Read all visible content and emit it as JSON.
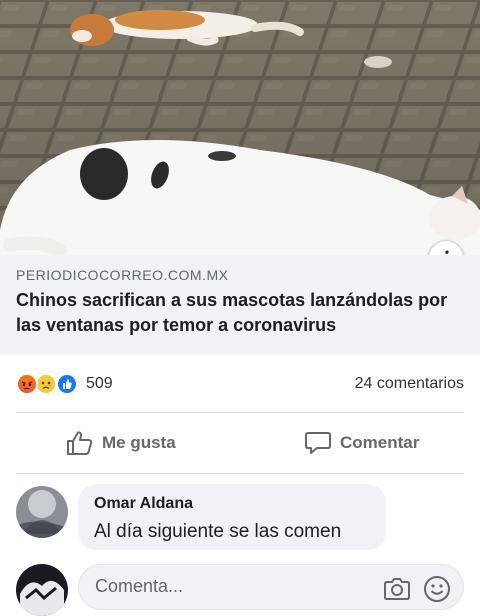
{
  "post": {
    "domain": "PERIODICOCORREO.COM.MX",
    "headline": "Chinos sacrifican a sus mascotas lanzándolas por las ventanas por temor a coronavirus",
    "image_alt_icon": "info-icon"
  },
  "reactions": {
    "count": "509",
    "types": [
      "angry",
      "sad",
      "like"
    ],
    "comments_count": "24 comentarios"
  },
  "actions": {
    "like_label": "Me gusta",
    "comment_label": "Comentar"
  },
  "comment": {
    "author": "Omar Aldana",
    "text": "Al día siguiente se las comen"
  },
  "composer": {
    "placeholder": "Comenta..."
  },
  "colors": {
    "link_preview_bg": "#f0f2f5",
    "like_blue": "#1877f2",
    "angry_orange": "#ff7a1a",
    "sad_yellow": "#f7c93b",
    "secondary_text": "#65676b"
  }
}
